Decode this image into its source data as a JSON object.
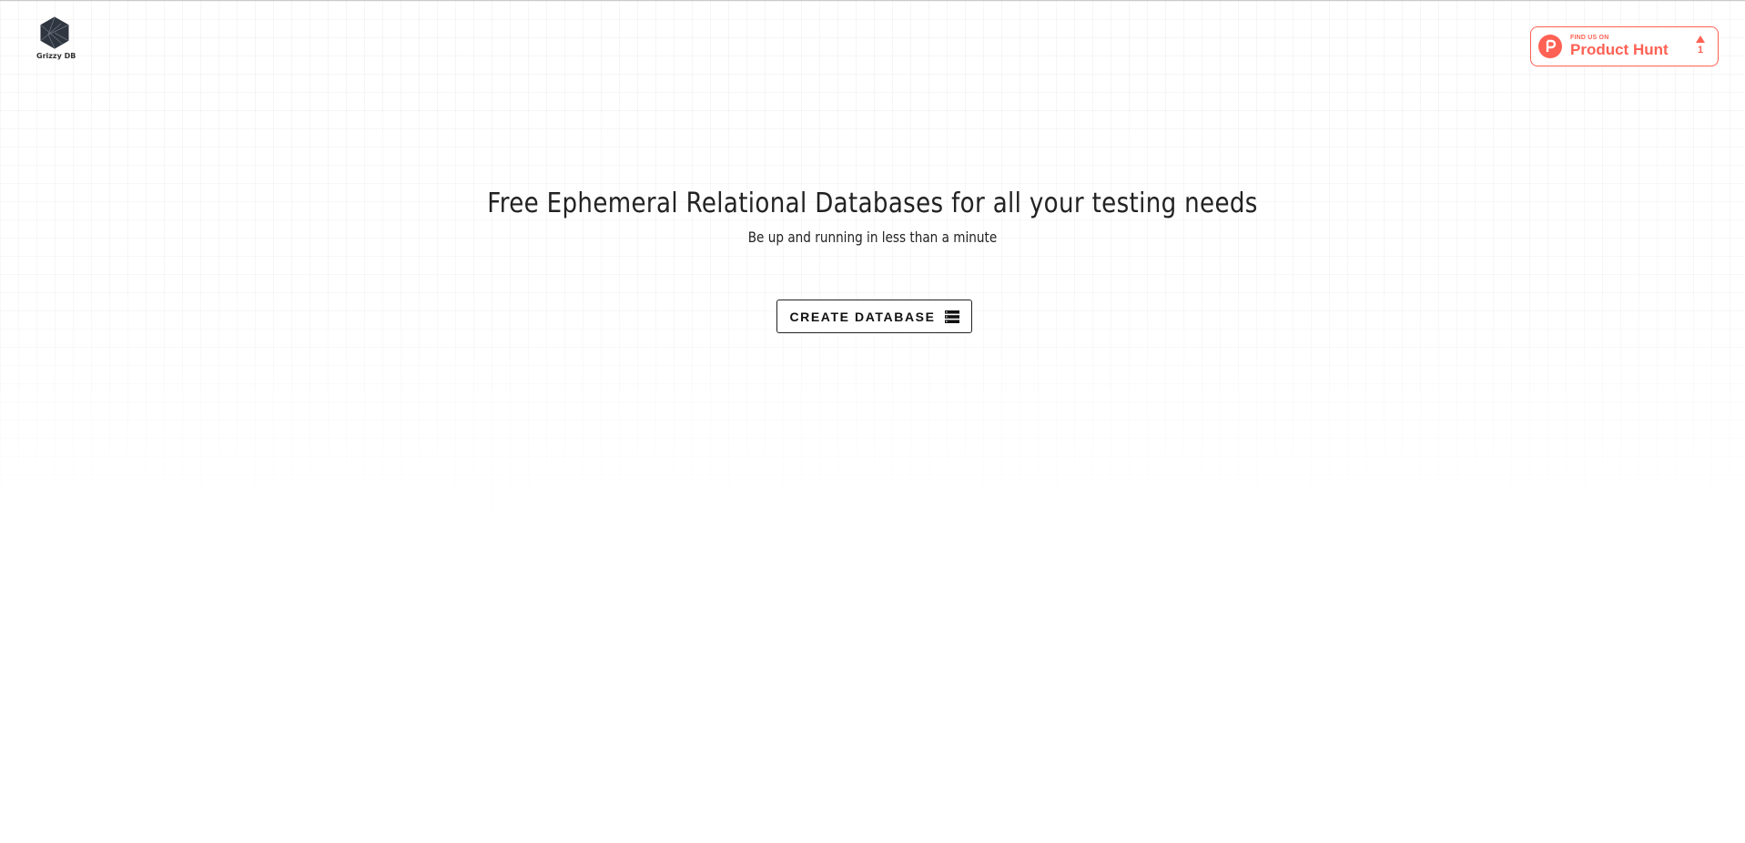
{
  "header": {
    "logo": {
      "text": "Grizzy DB",
      "icon": "hexagon-logo-icon"
    },
    "product_hunt_badge": {
      "small_label": "FIND US ON",
      "big_label": "Product Hunt",
      "votes": "1",
      "icon": "product-hunt-p-icon",
      "upvote_icon": "triangle-up-icon",
      "color": "#ff6154"
    }
  },
  "hero": {
    "title": "Free Ephemeral Relational Databases for all your testing needs",
    "subtitle": "Be up and running in less than a minute",
    "cta": {
      "label": "CREATE DATABASE",
      "icon": "database-rows-icon"
    }
  },
  "colors": {
    "background": "#ffffff",
    "text": "#222222",
    "accent": "#ff6154"
  }
}
